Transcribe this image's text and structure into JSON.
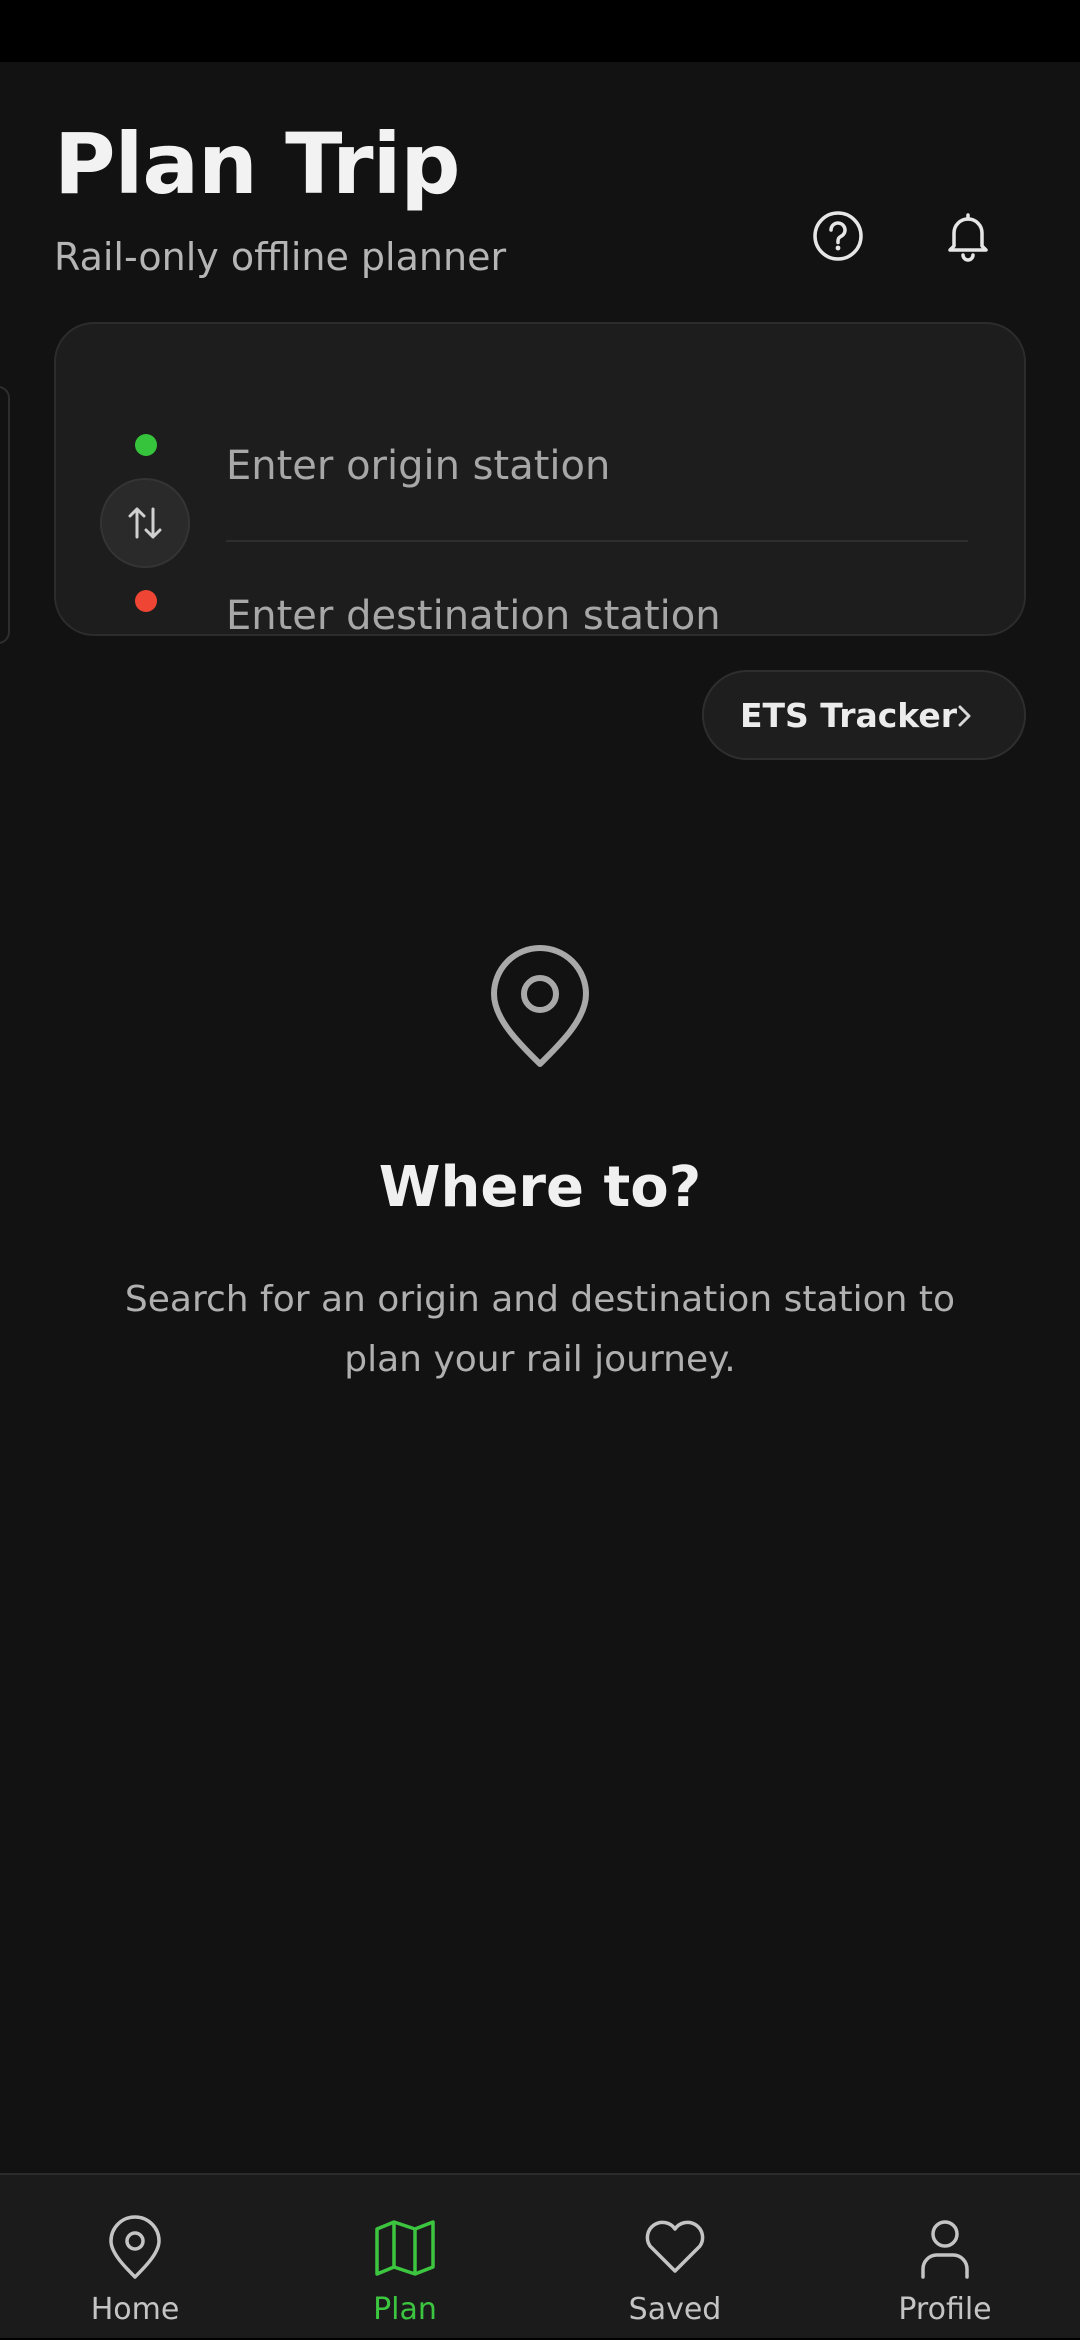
{
  "header": {
    "title": "Plan Trip",
    "subtitle": "Rail-only offline planner",
    "help_icon": "help-circle-icon",
    "notifications_icon": "bell-icon"
  },
  "search": {
    "origin_placeholder": "Enter origin station",
    "destination_placeholder": "Enter destination station",
    "origin_value": "",
    "destination_value": "",
    "swap_icon": "swap-vertical-icon",
    "origin_dot_color": "#35c43c",
    "destination_dot_color": "#ee4534"
  },
  "ets": {
    "label": "ETS Tracker",
    "icon": "chevron-right-icon"
  },
  "empty_state": {
    "icon": "map-pin-icon",
    "title": "Where to?",
    "body": "Search for an origin and destination station to plan your rail journey."
  },
  "nav": {
    "items": [
      {
        "label": "Home",
        "icon": "map-pin-icon",
        "active": false
      },
      {
        "label": "Plan",
        "icon": "map-icon",
        "active": true
      },
      {
        "label": "Saved",
        "icon": "heart-icon",
        "active": false
      },
      {
        "label": "Profile",
        "icon": "user-icon",
        "active": false
      }
    ],
    "accent_color": "#3cc640"
  }
}
